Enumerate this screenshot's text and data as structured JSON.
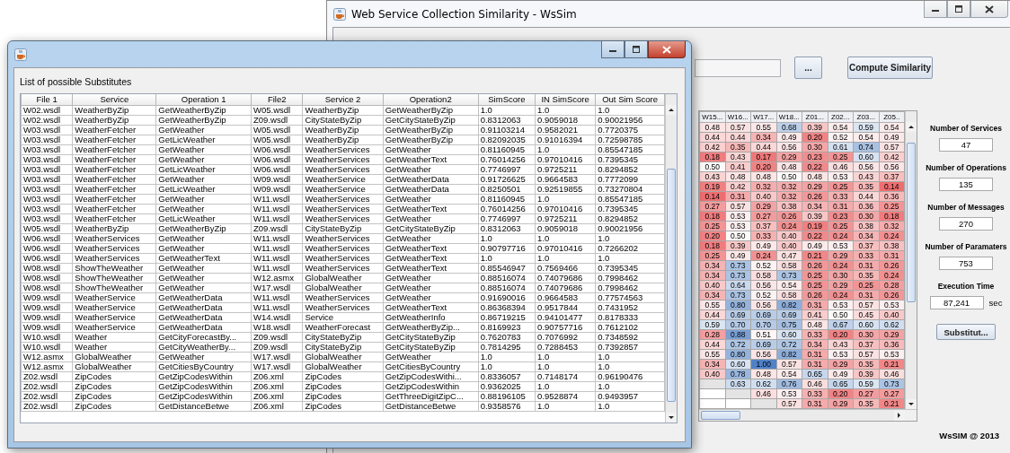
{
  "background_window": {
    "title": "Web Service Collection Similarity - WsSim",
    "browse_button": {
      "label": "..."
    },
    "compute_button": {
      "label": "Compute Similarity"
    },
    "heatmap": {
      "columns": [
        "W15...",
        "W16...",
        "W17...",
        "W18...",
        "Z01...",
        "Z02...",
        "Z03...",
        "Z05.."
      ],
      "rows": [
        [
          "0.48",
          "0.57",
          "0.55",
          "0.68",
          "0.39",
          "0.54",
          "0.59",
          "0.54"
        ],
        [
          "0.44",
          "0.44",
          "0.34",
          "0.49",
          "0.20",
          "0.52",
          "0.54",
          "0.49"
        ],
        [
          "0.42",
          "0.35",
          "0.44",
          "0.56",
          "0.30",
          "0.61",
          "0.74",
          "0.57"
        ],
        [
          "0.18",
          "0.43",
          "0.17",
          "0.29",
          "0.23",
          "0.25",
          "0.60",
          "0.42"
        ],
        [
          "0.50",
          "0.41",
          "0.20",
          "0.48",
          "0.22",
          "0.46",
          "0.56",
          "0.56"
        ],
        [
          "0.43",
          "0.48",
          "0.48",
          "0.50",
          "0.48",
          "0.53",
          "0.43",
          "0.37"
        ],
        [
          "0.19",
          "0.42",
          "0.32",
          "0.32",
          "0.29",
          "0.25",
          "0.35",
          "0.14"
        ],
        [
          "0.14",
          "0.31",
          "0.40",
          "0.32",
          "0.26",
          "0.33",
          "0.44",
          "0.36"
        ],
        [
          "0.27",
          "0.57",
          "0.29",
          "0.38",
          "0.34",
          "0.31",
          "0.36",
          "0.25"
        ],
        [
          "0.18",
          "0.53",
          "0.27",
          "0.26",
          "0.39",
          "0.23",
          "0.30",
          "0.18"
        ],
        [
          "0.25",
          "0.53",
          "0.37",
          "0.24",
          "0.19",
          "0.25",
          "0.38",
          "0.32"
        ],
        [
          "0.20",
          "0.50",
          "0.33",
          "0.40",
          "0.22",
          "0.24",
          "0.34",
          "0.24"
        ],
        [
          "0.18",
          "0.39",
          "0.49",
          "0.40",
          "0.49",
          "0.53",
          "0.37",
          "0.38"
        ],
        [
          "0.25",
          "0.49",
          "0.24",
          "0.47",
          "0.21",
          "0.29",
          "0.33",
          "0.31"
        ],
        [
          "0.34",
          "0.73",
          "0.52",
          "0.58",
          "0.26",
          "0.24",
          "0.31",
          "0.26"
        ],
        [
          "0.34",
          "0.73",
          "0.58",
          "0.73",
          "0.25",
          "0.30",
          "0.35",
          "0.24"
        ],
        [
          "0.40",
          "0.64",
          "0.56",
          "0.54",
          "0.25",
          "0.29",
          "0.25",
          "0.28"
        ],
        [
          "0.34",
          "0.73",
          "0.52",
          "0.58",
          "0.26",
          "0.24",
          "0.31",
          "0.26"
        ],
        [
          "0.55",
          "0.80",
          "0.56",
          "0.82",
          "0.31",
          "0.53",
          "0.57",
          "0.53"
        ],
        [
          "0.44",
          "0.69",
          "0.69",
          "0.69",
          "0.41",
          "0.50",
          "0.45",
          "0.40"
        ],
        [
          "0.59",
          "0.70",
          "0.70",
          "0.75",
          "0.48",
          "0.67",
          "0.60",
          "0.62"
        ],
        [
          "0.28",
          "0.88",
          "0.51",
          "0.60",
          "0.33",
          "0.20",
          "0.30",
          "0.29"
        ],
        [
          "0.44",
          "0.72",
          "0.69",
          "0.72",
          "0.34",
          "0.43",
          "0.37",
          "0.36"
        ],
        [
          "0.55",
          "0.80",
          "0.56",
          "0.82",
          "0.31",
          "0.53",
          "0.57",
          "0.53"
        ],
        [
          "0.34",
          "0.60",
          "1.00",
          "0.57",
          "0.31",
          "0.29",
          "0.35",
          "0.21"
        ],
        [
          "0.40",
          "0.78",
          "0.48",
          "0.54",
          "0.65",
          "0.49",
          "0.39",
          "0.46"
        ],
        [
          null,
          "0.63",
          "0.62",
          "0.76",
          "0.46",
          "0.65",
          "0.59",
          "0.73"
        ],
        [
          null,
          null,
          "0.46",
          "0.53",
          "0.33",
          "0.20",
          "0.27",
          "0.27"
        ],
        [
          null,
          null,
          null,
          "0.57",
          "0.31",
          "0.29",
          "0.35",
          "0.21"
        ]
      ]
    },
    "stats": [
      {
        "label": "Number of Services",
        "value": "47"
      },
      {
        "label": "Number of Operations",
        "value": "135"
      },
      {
        "label": "Number of Messages",
        "value": "270"
      },
      {
        "label": "Number of Paramaters",
        "value": "753"
      },
      {
        "label": "Execution Time",
        "value": "87,241",
        "unit": "sec"
      }
    ],
    "substitutes_button": {
      "label": "Substitut..."
    },
    "footer": "WsSIM @ 2013"
  },
  "dialog": {
    "label": "List of possible Substitutes",
    "table": {
      "columns": [
        "File 1",
        "Service",
        "Operation 1",
        "File2",
        "Service 2",
        "Operation2",
        "SimScore",
        "IN SimScore",
        "Out Sim Score"
      ],
      "rows": [
        [
          "W02.wsdl",
          "WeatherByZip",
          "GetWeatherByZip",
          "W05.wsdl",
          "WeatherByZip",
          "GetWeatherByZip",
          "1.0",
          "1.0",
          "1.0"
        ],
        [
          "W02.wsdl",
          "WeatherByZip",
          "GetWeatherByZip",
          "Z09.wsdl",
          "CityStateByZip",
          "GetCityStateByZip",
          "0.8312063",
          "0.9059018",
          "0.90021956"
        ],
        [
          "W03.wsdl",
          "WeatherFetcher",
          "GetWeather",
          "W05.wsdl",
          "WeatherByZip",
          "GetWeatherByZip",
          "0.91103214",
          "0.9582021",
          "0.7720375"
        ],
        [
          "W03.wsdl",
          "WeatherFetcher",
          "GetLicWeather",
          "W05.wsdl",
          "WeatherByZip",
          "GetWeatherByZip",
          "0.82092035",
          "0.91016394",
          "0.72598785"
        ],
        [
          "W03.wsdl",
          "WeatherFetcher",
          "GetWeather",
          "W06.wsdl",
          "WeatherServices",
          "GetWeather",
          "0.81160945",
          "1.0",
          "0.85547185"
        ],
        [
          "W03.wsdl",
          "WeatherFetcher",
          "GetWeather",
          "W06.wsdl",
          "WeatherServices",
          "GetWeatherText",
          "0.76014256",
          "0.97010416",
          "0.7395345"
        ],
        [
          "W03.wsdl",
          "WeatherFetcher",
          "GetLicWeather",
          "W06.wsdl",
          "WeatherServices",
          "GetWeather",
          "0.7746997",
          "0.9725211",
          "0.8294852"
        ],
        [
          "W03.wsdl",
          "WeatherFetcher",
          "GetWeather",
          "W09.wsdl",
          "WeatherService",
          "GetWeatherData",
          "0.91726625",
          "0.9664583",
          "0.7772099"
        ],
        [
          "W03.wsdl",
          "WeatherFetcher",
          "GetLicWeather",
          "W09.wsdl",
          "WeatherService",
          "GetWeatherData",
          "0.8250501",
          "0.92519855",
          "0.73270804"
        ],
        [
          "W03.wsdl",
          "WeatherFetcher",
          "GetWeather",
          "W11.wsdl",
          "WeatherServices",
          "GetWeather",
          "0.81160945",
          "1.0",
          "0.85547185"
        ],
        [
          "W03.wsdl",
          "WeatherFetcher",
          "GetWeather",
          "W11.wsdl",
          "WeatherServices",
          "GetWeatherText",
          "0.76014256",
          "0.97010416",
          "0.7395345"
        ],
        [
          "W03.wsdl",
          "WeatherFetcher",
          "GetLicWeather",
          "W11.wsdl",
          "WeatherServices",
          "GetWeather",
          "0.7746997",
          "0.9725211",
          "0.8294852"
        ],
        [
          "W05.wsdl",
          "WeatherByZip",
          "GetWeatherByZip",
          "Z09.wsdl",
          "CityStateByZip",
          "GetCityStateByZip",
          "0.8312063",
          "0.9059018",
          "0.90021956"
        ],
        [
          "W06.wsdl",
          "WeatherServices",
          "GetWeather",
          "W11.wsdl",
          "WeatherServices",
          "GetWeather",
          "1.0",
          "1.0",
          "1.0"
        ],
        [
          "W06.wsdl",
          "WeatherServices",
          "GetWeather",
          "W11.wsdl",
          "WeatherServices",
          "GetWeatherText",
          "0.90797716",
          "0.97010416",
          "0.7266202"
        ],
        [
          "W06.wsdl",
          "WeatherServices",
          "GetWeatherText",
          "W11.wsdl",
          "WeatherServices",
          "GetWeatherText",
          "1.0",
          "1.0",
          "1.0"
        ],
        [
          "W08.wsdl",
          "ShowTheWeather",
          "GetWeather",
          "W11.wsdl",
          "WeatherServices",
          "GetWeatherText",
          "0.85546947",
          "0.7569466",
          "0.7395345"
        ],
        [
          "W08.wsdl",
          "ShowTheWeather",
          "GetWeather",
          "W12.asmx",
          "GlobalWeather",
          "GetWeather",
          "0.88516074",
          "0.74079686",
          "0.7998462"
        ],
        [
          "W08.wsdl",
          "ShowTheWeather",
          "GetWeather",
          "W17.wsdl",
          "GlobalWeather",
          "GetWeather",
          "0.88516074",
          "0.74079686",
          "0.7998462"
        ],
        [
          "W09.wsdl",
          "WeatherService",
          "GetWeatherData",
          "W11.wsdl",
          "WeatherServices",
          "GetWeather",
          "0.91690016",
          "0.9664583",
          "0.77574563"
        ],
        [
          "W09.wsdl",
          "WeatherService",
          "GetWeatherData",
          "W11.wsdl",
          "WeatherServices",
          "GetWeatherText",
          "0.86368394",
          "0.9517844",
          "0.7431952"
        ],
        [
          "W09.wsdl",
          "WeatherService",
          "GetWeatherData",
          "W14.wsdl",
          "Service",
          "GetWeatherInfo",
          "0.86719215",
          "0.94101477",
          "0.8178333"
        ],
        [
          "W09.wsdl",
          "WeatherService",
          "GetWeatherData",
          "W18.wsdl",
          "WeatherForecast",
          "GetWeatherByZip...",
          "0.8169923",
          "0.90757716",
          "0.7612102"
        ],
        [
          "W10.wsdl",
          "Weather",
          "GetCityForecastBy...",
          "Z09.wsdl",
          "CityStateByZip",
          "GetCityStateByZip",
          "0.7620783",
          "0.7076992",
          "0.7348592"
        ],
        [
          "W10.wsdl",
          "Weather",
          "GetCityWeatherBy...",
          "Z09.wsdl",
          "CityStateByZip",
          "GetCityStateByZip",
          "0.7814295",
          "0.7288453",
          "0.7392857"
        ],
        [
          "W12.asmx",
          "GlobalWeather",
          "GetWeather",
          "W17.wsdl",
          "GlobalWeather",
          "GetWeather",
          "1.0",
          "1.0",
          "1.0"
        ],
        [
          "W12.asmx",
          "GlobalWeather",
          "GetCitiesByCountry",
          "W17.wsdl",
          "GlobalWeather",
          "GetCitiesByCountry",
          "1.0",
          "1.0",
          "1.0"
        ],
        [
          "Z02.wsdl",
          "ZipCodes",
          "GetZipCodesWithin",
          "Z06.xml",
          "ZipCodes",
          "GetZipCodesWithi...",
          "0.8336057",
          "0.7148174",
          "0.96190476"
        ],
        [
          "Z02.wsdl",
          "ZipCodes",
          "GetZipCodesWithin",
          "Z06.xml",
          "ZipCodes",
          "GetZipCodesWithin",
          "0.9362025",
          "1.0",
          "1.0"
        ],
        [
          "Z02.wsdl",
          "ZipCodes",
          "GetZipCodesWithin",
          "Z06.xml",
          "ZipCodes",
          "GetThreeDigitZipC...",
          "0.88196105",
          "0.9528874",
          "0.9493957"
        ],
        [
          "Z02.wsdl",
          "ZipCodes",
          "GetDistanceBetwe",
          "Z06.xml",
          "ZipCodes",
          "GetDistanceBetwe",
          "0.9358576",
          "1.0",
          "1.0"
        ]
      ]
    }
  }
}
